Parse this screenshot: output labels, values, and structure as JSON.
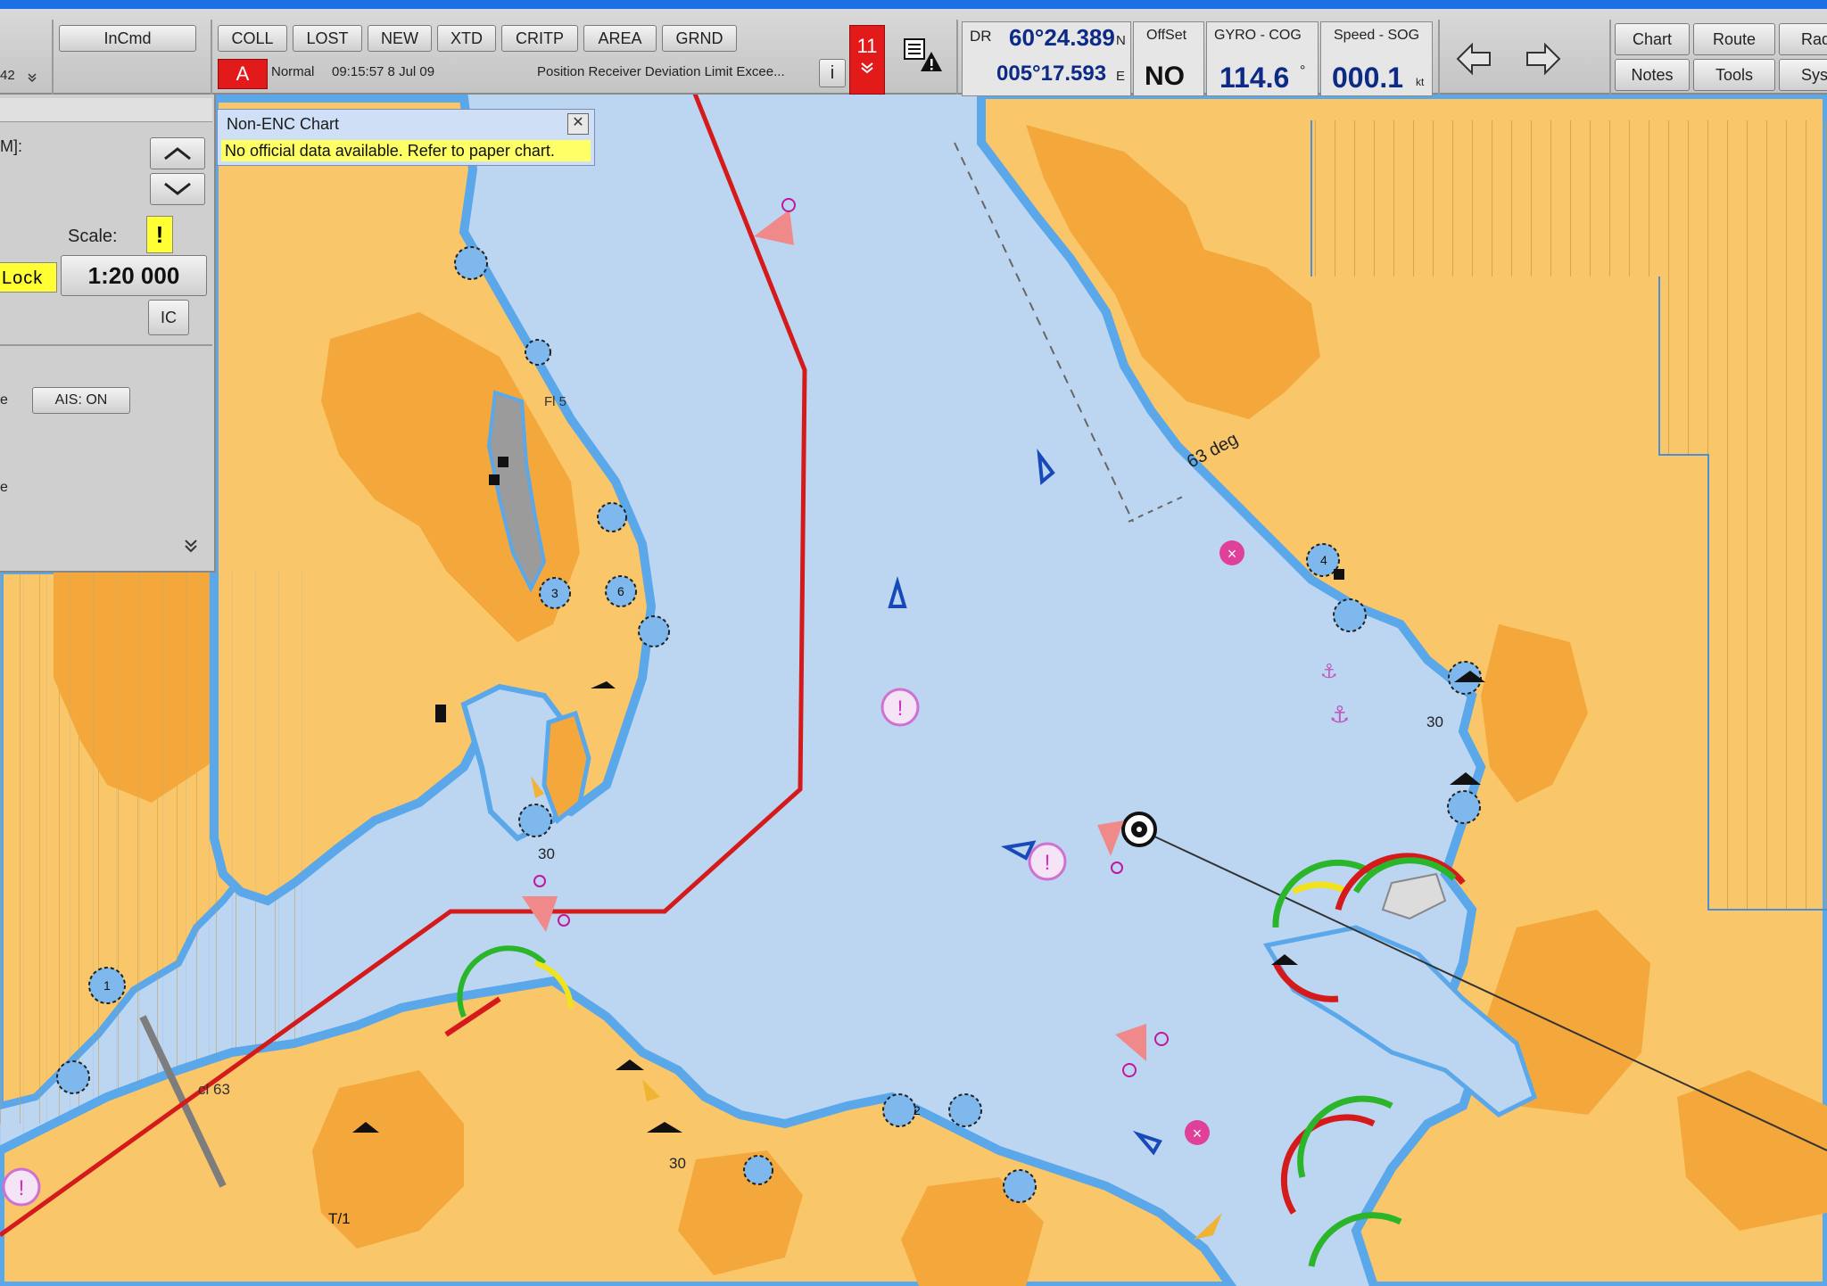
{
  "toolbar": {
    "incmd_label": "InCmd",
    "left_partial": "42",
    "mode_buttons": [
      "COLL",
      "LOST",
      "NEW",
      "XTD",
      "CRITP",
      "AREA",
      "GRND"
    ],
    "alarm_letter": "A",
    "alarm_mode": "Normal",
    "alarm_time": "09:15:57 8 Jul 09",
    "alarm_message": "Position Receiver Deviation Limit Excee...",
    "alarm_count": "11",
    "info_icon_label": "i"
  },
  "position": {
    "source_label": "DR",
    "latitude": "60°24.389",
    "lat_hemisphere": "N",
    "longitude": "005°17.593",
    "lon_hemisphere": "E"
  },
  "offset": {
    "label": "OffSet",
    "value": "NO"
  },
  "gyro": {
    "label": "GYRO - COG",
    "value": "114.6",
    "unit": "°"
  },
  "speed": {
    "label": "Speed - SOG",
    "value": "000.1",
    "unit": "kt"
  },
  "right_menu": {
    "row1": [
      "Chart",
      "Route",
      "Rad"
    ],
    "row2": [
      "Notes",
      "Tools",
      "Sys"
    ]
  },
  "left_panel": {
    "range_label": "M]:",
    "scale_label": "Scale:",
    "scale_warning": "!",
    "lock_label": "Lock",
    "scale_value": "1:20 000",
    "ic_button": "IC",
    "ais_button": "AIS: ON",
    "row_label_e1": "e",
    "row_label_e2": "e"
  },
  "enc_popup": {
    "title": "Non-ENC Chart",
    "message": "No official data available. Refer to paper chart.",
    "close": "✕"
  },
  "chart_labels": {
    "heading_label": "63 deg",
    "depth_30_a": "30",
    "depth_30_b": "30",
    "depth_30_c": "30",
    "depth_30_d": "30",
    "cl_label": "cl 63",
    "fl_label": "Fl 5",
    "buoy_1a": "1",
    "buoy_3": "3",
    "buoy_6": "6",
    "buoy_4": "4",
    "buoy_2": "2",
    "tt_label": "T/1"
  },
  "colors": {
    "water": "#bcd6f2",
    "land": "#f9c66a",
    "land_dark": "#f4a83c",
    "shore": "#5aa7ea",
    "route": "#d41a1a"
  }
}
